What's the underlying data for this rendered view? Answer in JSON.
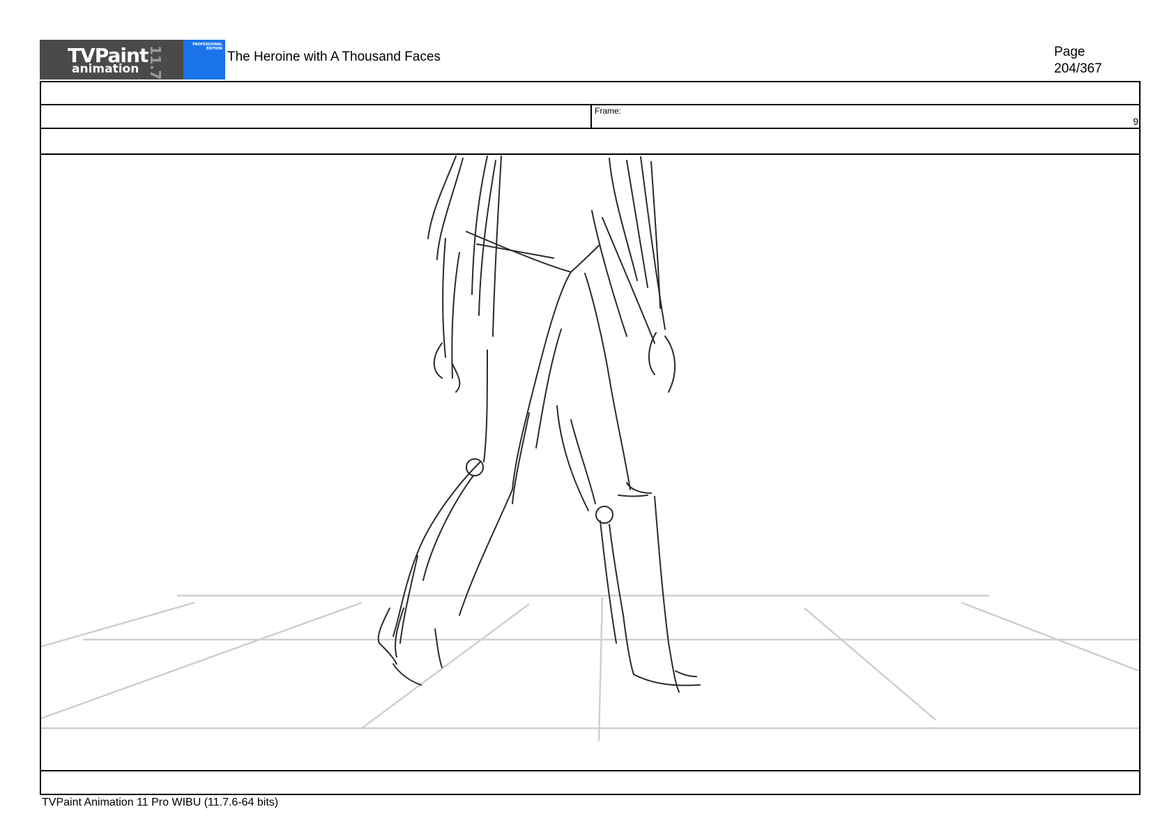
{
  "logo": {
    "line1": "TVPaint",
    "line2": "animation",
    "version": "11.7",
    "edition": "PROFESSIONAL EDITION"
  },
  "header": {
    "title": "The Heroine with A Thousand Faces",
    "page_label": "Page",
    "page_value": "204/367"
  },
  "sheet": {
    "frame_label": "Frame:",
    "frame_number": "9"
  },
  "footer": {
    "text": "TVPaint Animation 11 Pro WIBU (11.7.6-64 bits)"
  },
  "colors": {
    "logo_dark": "#4a4a4a",
    "logo_blue": "#1a73e8",
    "sketch": "#2a2a2a",
    "floor_lines": "#c8c8c8"
  }
}
